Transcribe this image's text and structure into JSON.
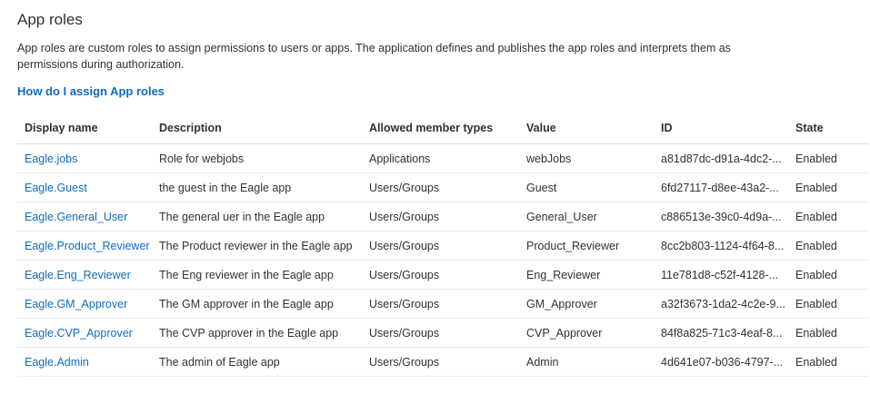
{
  "section": {
    "title": "App roles",
    "description": "App roles are custom roles to assign permissions to users or apps. The application defines and publishes the app roles and interprets them as permissions during authorization.",
    "help_link": "How do I assign App roles"
  },
  "table": {
    "headers": {
      "display_name": "Display name",
      "description": "Description",
      "allowed_member_types": "Allowed member types",
      "value": "Value",
      "id": "ID",
      "state": "State"
    },
    "rows": [
      {
        "display_name": "Eagle.jobs",
        "description": "Role for webjobs",
        "allowed_member_types": "Applications",
        "value": "webJobs",
        "id": "a81d87dc-d91a-4dc2-...",
        "state": "Enabled"
      },
      {
        "display_name": "Eagle.Guest",
        "description": "the guest in the Eagle app",
        "allowed_member_types": "Users/Groups",
        "value": "Guest",
        "id": "6fd27117-d8ee-43a2-...",
        "state": "Enabled"
      },
      {
        "display_name": "Eagle.General_User",
        "description": "The general uer in the Eagle app",
        "allowed_member_types": "Users/Groups",
        "value": "General_User",
        "id": "c886513e-39c0-4d9a-...",
        "state": "Enabled"
      },
      {
        "display_name": "Eagle.Product_Reviewer",
        "description": "The Product reviewer in the Eagle app",
        "allowed_member_types": "Users/Groups",
        "value": "Product_Reviewer",
        "id": "8cc2b803-1124-4f64-8...",
        "state": "Enabled"
      },
      {
        "display_name": "Eagle.Eng_Reviewer",
        "description": "The Eng reviewer in the Eagle app",
        "allowed_member_types": "Users/Groups",
        "value": "Eng_Reviewer",
        "id": "11e781d8-c52f-4128-...",
        "state": "Enabled"
      },
      {
        "display_name": "Eagle.GM_Approver",
        "description": "The GM approver in the Eagle app",
        "allowed_member_types": "Users/Groups",
        "value": "GM_Approver",
        "id": "a32f3673-1da2-4c2e-9...",
        "state": "Enabled"
      },
      {
        "display_name": "Eagle.CVP_Approver",
        "description": "The CVP approver in the Eagle app",
        "allowed_member_types": "Users/Groups",
        "value": "CVP_Approver",
        "id": "84f8a825-71c3-4eaf-8...",
        "state": "Enabled"
      },
      {
        "display_name": "Eagle.Admin",
        "description": "The admin of Eagle app",
        "allowed_member_types": "Users/Groups",
        "value": "Admin",
        "id": "4d641e07-b036-4797-...",
        "state": "Enabled"
      }
    ]
  },
  "colors": {
    "link": "#0f6cbd",
    "text": "#323130",
    "divider": "#edebe9"
  }
}
